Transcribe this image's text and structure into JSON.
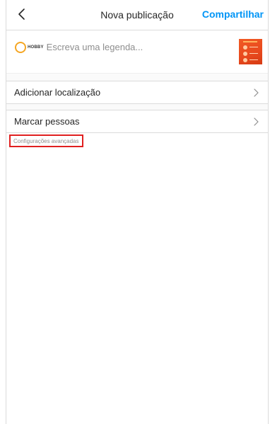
{
  "header": {
    "title": "Nova publicação",
    "share_label": "Compartilhar"
  },
  "caption": {
    "placeholder": "Escreva uma legenda...",
    "brand_logo_text": "HOBBY"
  },
  "options": [
    {
      "label": "Adicionar localização"
    },
    {
      "label": "Marcar pessoas"
    }
  ],
  "advanced_label": "Configurações avançadas",
  "colors": {
    "accent": "#0095f6",
    "highlight_border": "#e02020",
    "thumbnail": "#f15a24"
  },
  "icons": {
    "back": "chevron-left-icon",
    "option_arrow": "chevron-right-icon"
  }
}
